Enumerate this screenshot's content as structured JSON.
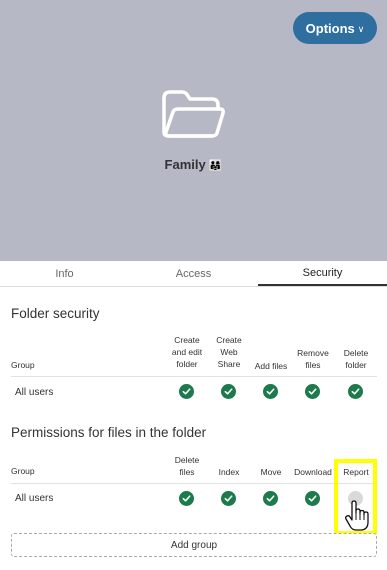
{
  "header": {
    "options_label": "Options",
    "chevron_glyph": "∨",
    "folder_name": "Family",
    "folder_emoji": "👨‍👩‍👧"
  },
  "tabs": [
    {
      "label": "Info",
      "active": false
    },
    {
      "label": "Access",
      "active": false
    },
    {
      "label": "Security",
      "active": true
    }
  ],
  "folder_security": {
    "title": "Folder security",
    "group_header": "Group",
    "columns": [
      "Create and edit folder",
      "Create Web Share",
      "Add files",
      "Remove files",
      "Delete folder"
    ],
    "rows": [
      {
        "group": "All users",
        "values": [
          true,
          true,
          true,
          true,
          true
        ]
      }
    ]
  },
  "file_permissions": {
    "title": "Permissions for files in the folder",
    "group_header": "Group",
    "columns": [
      "Delete files",
      "Index",
      "Move",
      "Download",
      "Report"
    ],
    "rows": [
      {
        "group": "All users",
        "values": [
          true,
          true,
          true,
          true,
          false
        ]
      }
    ]
  },
  "add_group_label": "Add group",
  "colors": {
    "hero_bg": "#b6b8c5",
    "accent": "#2f6f9f",
    "check_on": "#1c7a4c",
    "check_off": "#d9d9d9",
    "highlight": "#ffff00"
  }
}
